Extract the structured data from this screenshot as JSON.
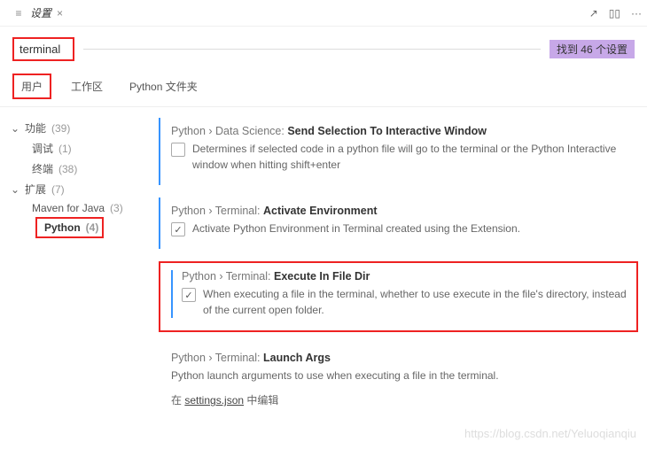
{
  "tab": {
    "title": "设置",
    "close": "×"
  },
  "titlebar_icons": {
    "open_json": "↗",
    "split": "▯▯",
    "more": "···"
  },
  "search": {
    "value": "terminal",
    "count_label": "找到 46 个设置"
  },
  "scope_tabs": {
    "user": "用户",
    "workspace": "工作区",
    "folder": "Python 文件夹"
  },
  "sidebar": {
    "features": {
      "label": "功能",
      "count": "(39)"
    },
    "debug": {
      "label": "调试",
      "count": "(1)"
    },
    "terminal": {
      "label": "终端",
      "count": "(38)"
    },
    "extensions": {
      "label": "扩展",
      "count": "(7)"
    },
    "maven": {
      "label": "Maven for Java",
      "count": "(3)"
    },
    "python": {
      "label": "Python",
      "count": "(4)"
    }
  },
  "settings": {
    "s1": {
      "crumb": "Python › Data Science: ",
      "name": "Send Selection To Interactive Window",
      "desc": "Determines if selected code in a python file will go to the terminal or the Python Interactive window when hitting shift+enter",
      "checked": ""
    },
    "s2": {
      "crumb": "Python › Terminal: ",
      "name": "Activate Environment",
      "desc": "Activate Python Environment in Terminal created using the Extension.",
      "checked": "✓"
    },
    "s3": {
      "crumb": "Python › Terminal: ",
      "name": "Execute In File Dir",
      "desc": "When executing a file in the terminal, whether to use execute in the file's directory, instead of the current open folder.",
      "checked": "✓"
    },
    "s4": {
      "crumb": "Python › Terminal: ",
      "name": "Launch Args",
      "desc": "Python launch arguments to use when executing a file in the terminal.",
      "link_pre": "在 ",
      "link": "settings.json",
      "link_post": " 中编辑"
    }
  },
  "watermark": "https://blog.csdn.net/Yeluoqianqiu"
}
